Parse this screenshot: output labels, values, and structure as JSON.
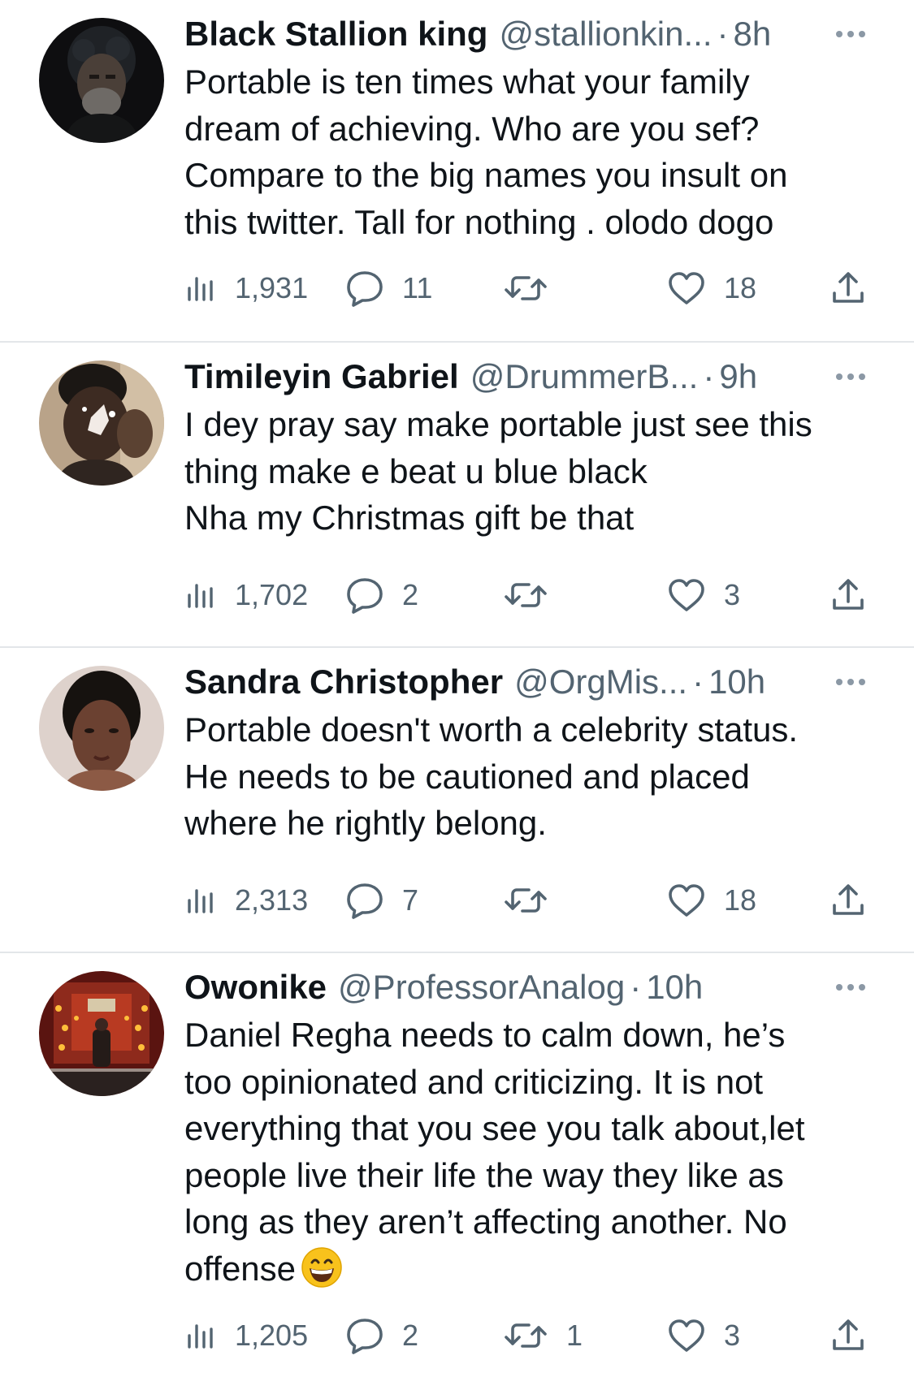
{
  "colors": {
    "text_primary": "#0f1419",
    "text_secondary": "#536471",
    "divider": "#e3e6e9",
    "icon": "#536471"
  },
  "icons": {
    "views": "bar-chart-icon",
    "reply": "speech-bubble-icon",
    "retweet": "retweet-arrows-icon",
    "like": "heart-icon",
    "share": "upload-arrow-icon",
    "more": "three-dots-icon"
  },
  "tweets": [
    {
      "name": "Black Stallion king",
      "handle": "@stallionkin...",
      "separator": "·",
      "time": "8h",
      "text": "Portable is ten times what your family\ndream of achieving. Who are you sef?\nCompare to the big names you insult on\nthis twitter. Tall for nothing . olodo dogo",
      "views": "1,931",
      "replies": "11",
      "retweets": "",
      "likes": "18"
    },
    {
      "name": "Timileyin Gabriel",
      "handle": "@DrummerB...",
      "separator": "·",
      "time": "9h",
      "text": "I dey pray say make portable just see this\nthing make e beat u blue black\nNha my Christmas gift be that",
      "views": "1,702",
      "replies": "2",
      "retweets": "",
      "likes": "3"
    },
    {
      "name": "Sandra Christopher",
      "handle": "@OrgMis...",
      "separator": "·",
      "time": "10h",
      "text": "Portable doesn't worth a celebrity status.\nHe needs to be cautioned and placed\nwhere he rightly belong.",
      "views": "2,313",
      "replies": "7",
      "retweets": "",
      "likes": "18"
    },
    {
      "name": "Owonike",
      "handle": "@ProfessorAnalog",
      "separator": "·",
      "time": "10h",
      "text": "Daniel Regha needs to calm down, he’s\ntoo opinionated and criticizing. It is not\neverything that you see you talk about,let\npeople live their life the way they like as\nlong as they aren’t affecting another. No\noffense",
      "views": "1,205",
      "replies": "2",
      "retweets": "1",
      "likes": "3"
    }
  ]
}
